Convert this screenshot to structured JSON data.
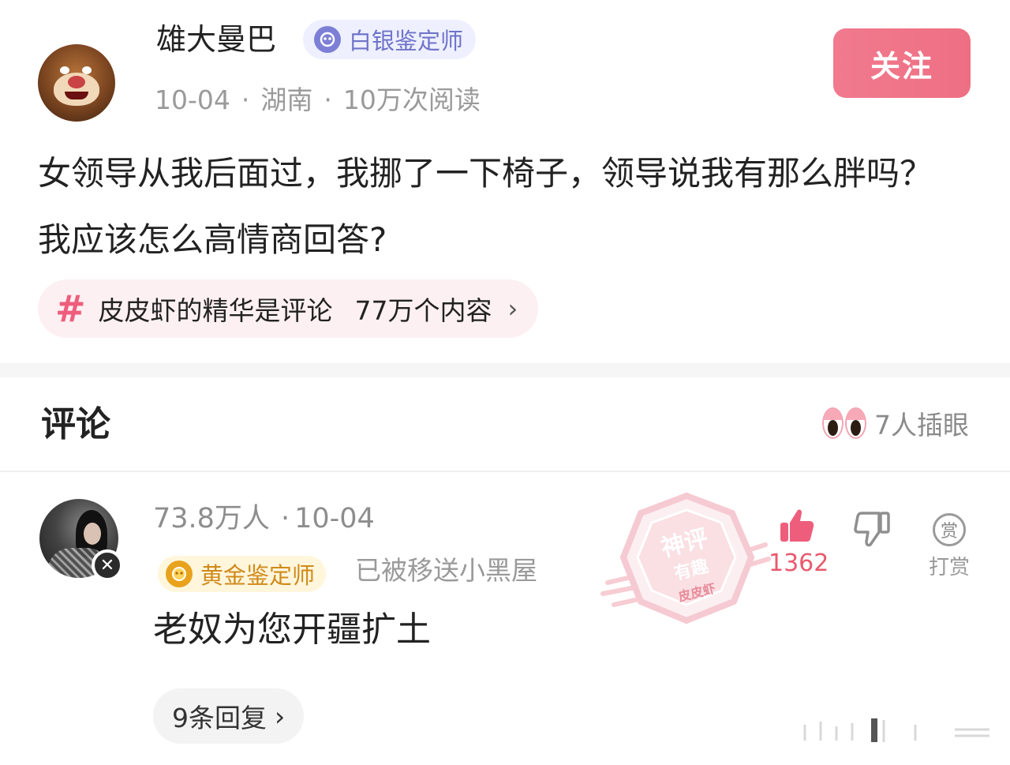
{
  "post": {
    "author": "雄大曼巴",
    "badge": "白银鉴定师",
    "date": "10-04",
    "location": "湖南",
    "reads": "10万次阅读",
    "follow_label": "关注",
    "text": "女领导从我后面过，我挪了一下椅子，领导说我有那么胖吗？　我应该怎么高情商回答?",
    "topic": {
      "name": "皮皮虾的精华是评论",
      "count": "77万个内容",
      "chevron": "›"
    }
  },
  "comments_section": {
    "title": "评论",
    "peek_text": "7人插眼"
  },
  "comment": {
    "author_label": "73.8万人",
    "date": "10-04",
    "badge": "黄金鉴定师",
    "status": "已被移送小黑屋",
    "text": "老奴为您开疆扩土",
    "reply_label": "9条回复",
    "reply_chevron": "›",
    "like_count": "1362",
    "reward_icon_char": "赏",
    "reward_label": "打赏",
    "stamp": {
      "line1": "神评",
      "line2": "有趣",
      "line3": "皮皮虾"
    }
  },
  "separator": "·",
  "colors": {
    "accent_pink": "#ee6f83",
    "like_red": "#e85a6e",
    "silver_badge": "#7d7fd6",
    "gold_badge": "#e8a21c"
  },
  "icons": [
    "hash-icon",
    "chevron-right-icon",
    "eyes-peek-icon",
    "thumbs-up-icon",
    "thumbs-down-icon",
    "reward-icon",
    "ban-icon"
  ]
}
